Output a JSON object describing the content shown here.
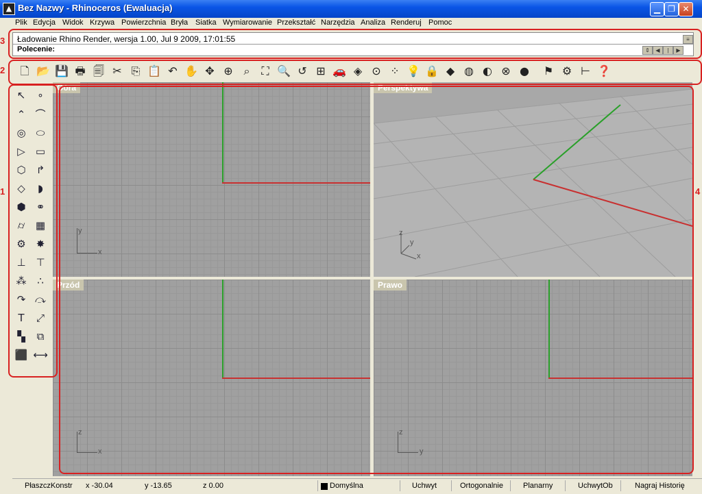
{
  "window": {
    "title": "Bez Nazwy - Rhinoceros (Ewaluacja)"
  },
  "menu": [
    "Plik",
    "Edycja",
    "Widok",
    "Krzywa",
    "Powierzchnia",
    "Bryła",
    "Siatka",
    "Wymiarowanie",
    "Przekształć",
    "Narzędzia",
    "Analiza",
    "Renderuj",
    "Pomoc"
  ],
  "command": {
    "history": "Ładowanie Rhino Render, wersja 1.00, Jul  9 2009, 17:01:55",
    "prompt": "Polecenie:"
  },
  "viewports": {
    "top": {
      "label": "Góra",
      "x_axis": "x",
      "y_axis": "y"
    },
    "perspective": {
      "label": "Perspektywa",
      "x_axis": "x",
      "y_axis": "y",
      "z_axis": "z"
    },
    "front": {
      "label": "Przód",
      "x_axis": "x",
      "y_axis": "z"
    },
    "right": {
      "label": "Prawo",
      "x_axis": "y",
      "y_axis": "z"
    }
  },
  "status": {
    "cplane": "PłaszczKonstr",
    "x": "x -30.04",
    "y": "y -13.65",
    "z": "z 0.00",
    "layer": "Domyślna",
    "snap": "Uchwyt",
    "ortho": "Ortogonalnie",
    "planar": "Planarny",
    "osnap": "UchwytOb",
    "history": "Nagraj Historię"
  },
  "annotations": {
    "n1": "1",
    "n2": "2",
    "n3": "3",
    "n4": "4"
  },
  "colors": {
    "x_axis": "#c83030",
    "y_axis": "#2aa02a",
    "annotation": "#d82020"
  }
}
